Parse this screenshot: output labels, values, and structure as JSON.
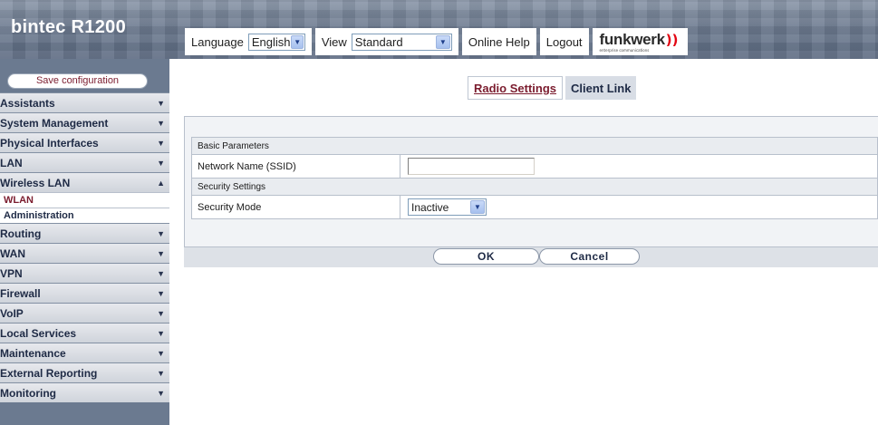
{
  "header": {
    "brand": "bintec R1200",
    "language_label": "Language",
    "language_value": "English",
    "view_label": "View",
    "view_value": "Standard",
    "online_help": "Online Help",
    "logout": "Logout",
    "logo_text": "funkwerk",
    "logo_subtext": "enterprise communications",
    "logo_mark": "))"
  },
  "sidebar": {
    "save_label": "Save configuration",
    "items": [
      {
        "label": "Assistants"
      },
      {
        "label": "System Management"
      },
      {
        "label": "Physical Interfaces"
      },
      {
        "label": "LAN"
      },
      {
        "label": "Wireless LAN",
        "expanded": true,
        "subitems": [
          "WLAN",
          "Administration"
        ]
      },
      {
        "label": "Routing"
      },
      {
        "label": "WAN"
      },
      {
        "label": "VPN"
      },
      {
        "label": "Firewall"
      },
      {
        "label": "VoIP"
      },
      {
        "label": "Local Services"
      },
      {
        "label": "Maintenance"
      },
      {
        "label": "External Reporting"
      },
      {
        "label": "Monitoring"
      }
    ]
  },
  "tabs": {
    "radio_settings": "Radio Settings",
    "client_link": "Client Link"
  },
  "form": {
    "basic_parameters": "Basic Parameters",
    "ssid_label": "Network Name (SSID)",
    "ssid_value": "",
    "security_settings": "Security Settings",
    "security_mode_label": "Security Mode",
    "security_mode_value": "Inactive"
  },
  "buttons": {
    "ok": "OK",
    "cancel": "Cancel"
  },
  "colors": {
    "accent": "#7b1c2e",
    "header_bg": "#6d7b90",
    "logo_red": "#e30613"
  }
}
